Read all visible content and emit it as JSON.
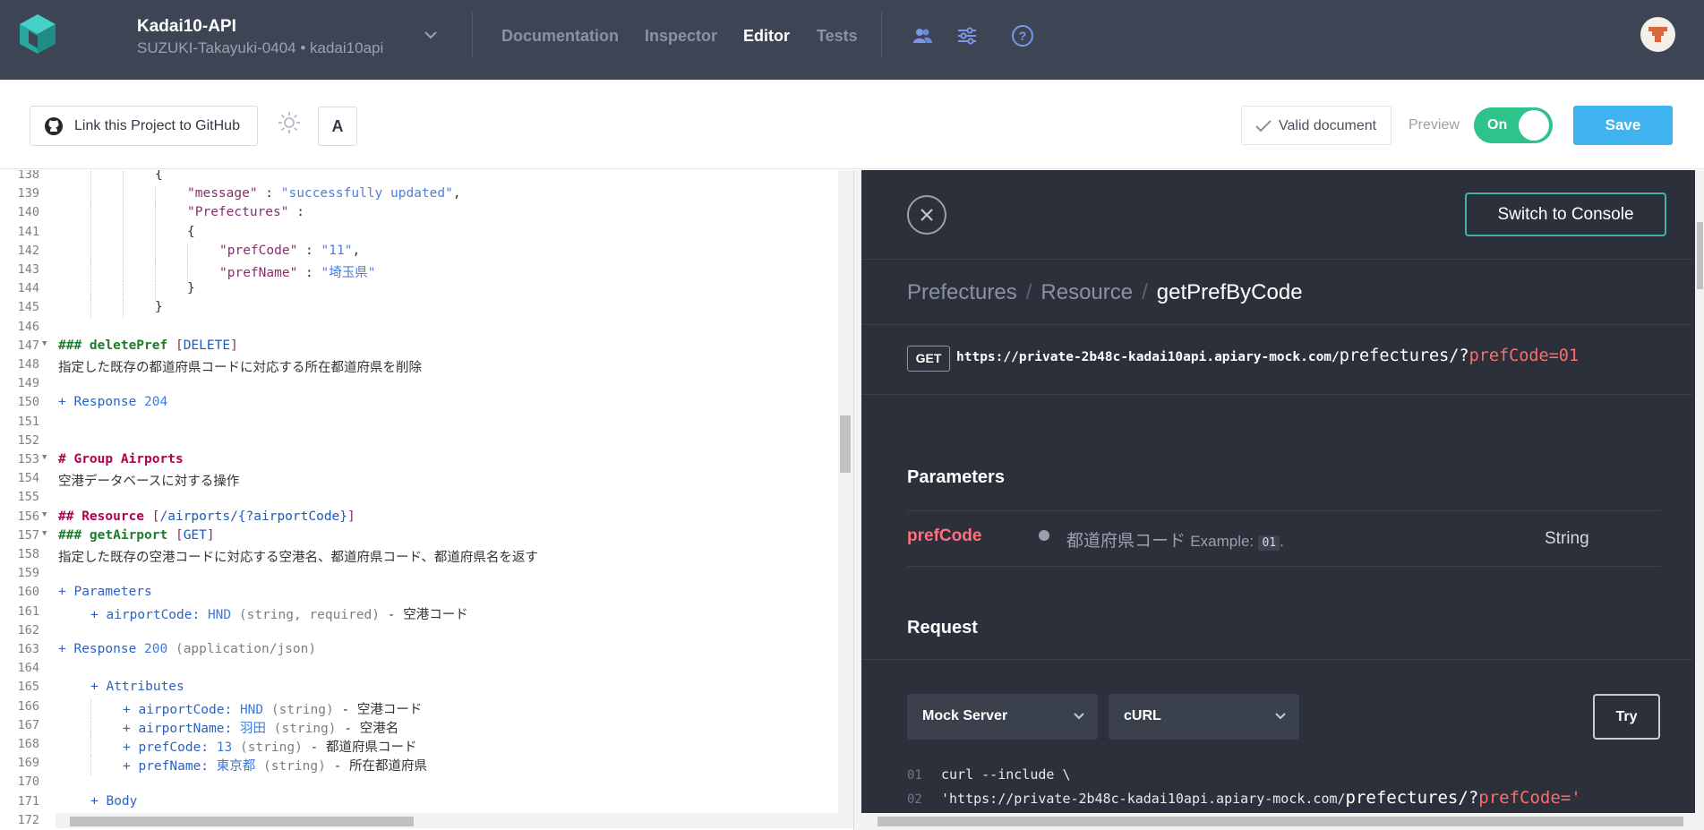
{
  "header": {
    "project_name": "Kadai10-API",
    "project_sub": "SUZUKI-Takayuki-0404 • kadai10api",
    "nav": [
      "Documentation",
      "Inspector",
      "Editor",
      "Tests"
    ],
    "active_nav": "Editor"
  },
  "toolbar": {
    "github_label": "Link this Project to GitHub",
    "font_label": "A",
    "valid_label": "Valid document",
    "preview_label": "Preview",
    "toggle_label": "On",
    "save_label": "Save"
  },
  "editor": {
    "lines": [
      {
        "num": "138",
        "fold": false,
        "indent": 3,
        "segs": [
          [
            "",
            "{"
          ]
        ]
      },
      {
        "num": "139",
        "fold": false,
        "indent": 4,
        "segs": [
          [
            "c-key",
            "\"message\""
          ],
          [
            "",
            " : "
          ],
          [
            "c-str",
            "\"successfully updated\""
          ],
          [
            "",
            ","
          ]
        ]
      },
      {
        "num": "140",
        "fold": false,
        "indent": 4,
        "segs": [
          [
            "c-key",
            "\"Prefectures\""
          ],
          [
            "",
            " :"
          ]
        ]
      },
      {
        "num": "141",
        "fold": false,
        "indent": 4,
        "segs": [
          [
            "",
            "{"
          ]
        ]
      },
      {
        "num": "142",
        "fold": false,
        "indent": 5,
        "segs": [
          [
            "c-key",
            "\"prefCode\""
          ],
          [
            "",
            " : "
          ],
          [
            "c-str",
            "\"11\""
          ],
          [
            "",
            ","
          ]
        ]
      },
      {
        "num": "143",
        "fold": false,
        "indent": 5,
        "segs": [
          [
            "c-key",
            "\"prefName\""
          ],
          [
            "",
            " : "
          ],
          [
            "c-str",
            "\"埼玉県\""
          ]
        ]
      },
      {
        "num": "144",
        "fold": false,
        "indent": 4,
        "segs": [
          [
            "",
            "}"
          ]
        ]
      },
      {
        "num": "145",
        "fold": false,
        "indent": 3,
        "segs": [
          [
            "",
            "}"
          ]
        ]
      },
      {
        "num": "146",
        "fold": false,
        "indent": 0,
        "segs": []
      },
      {
        "num": "147",
        "fold": true,
        "indent": 0,
        "segs": [
          [
            "c-green",
            "### deletePref "
          ],
          [
            "c-key",
            "["
          ],
          [
            "c-blue",
            "DELETE"
          ],
          [
            "c-key",
            "]"
          ]
        ]
      },
      {
        "num": "148",
        "fold": false,
        "indent": 0,
        "segs": [
          [
            "",
            "指定した既存の都道府県コードに対応する所在都道府県を削除"
          ]
        ]
      },
      {
        "num": "149",
        "fold": false,
        "indent": 0,
        "segs": []
      },
      {
        "num": "150",
        "fold": false,
        "indent": 0,
        "segs": [
          [
            "c-plus",
            "+ Response "
          ],
          [
            "c-val",
            "204"
          ]
        ]
      },
      {
        "num": "151",
        "fold": false,
        "indent": 0,
        "segs": []
      },
      {
        "num": "152",
        "fold": false,
        "indent": 0,
        "segs": []
      },
      {
        "num": "153",
        "fold": true,
        "indent": 0,
        "segs": [
          [
            "c-head",
            "# Group Airports"
          ]
        ]
      },
      {
        "num": "154",
        "fold": false,
        "indent": 0,
        "segs": [
          [
            "",
            "空港データベースに対する操作"
          ]
        ]
      },
      {
        "num": "155",
        "fold": false,
        "indent": 0,
        "segs": []
      },
      {
        "num": "156",
        "fold": true,
        "indent": 0,
        "segs": [
          [
            "c-head",
            "## Resource "
          ],
          [
            "c-key",
            "["
          ],
          [
            "c-blue",
            "/airports/{?airportCode}"
          ],
          [
            "c-key",
            "]"
          ]
        ]
      },
      {
        "num": "157",
        "fold": true,
        "indent": 0,
        "segs": [
          [
            "c-green",
            "### getAirport "
          ],
          [
            "c-key",
            "["
          ],
          [
            "c-blue",
            "GET"
          ],
          [
            "c-key",
            "]"
          ]
        ]
      },
      {
        "num": "158",
        "fold": false,
        "indent": 0,
        "segs": [
          [
            "",
            "指定した既存の空港コードに対応する空港名、都道府県コード、都道府県名を返す"
          ]
        ]
      },
      {
        "num": "159",
        "fold": false,
        "indent": 0,
        "segs": []
      },
      {
        "num": "160",
        "fold": false,
        "indent": 0,
        "segs": [
          [
            "c-plus",
            "+ Parameters"
          ]
        ]
      },
      {
        "num": "161",
        "fold": false,
        "indent": 1,
        "segs": [
          [
            "c-plus",
            "+ airportCode: "
          ],
          [
            "c-val",
            "HND"
          ],
          [
            "c-gray",
            " (string, required)"
          ],
          [
            "",
            " - 空港コード"
          ]
        ]
      },
      {
        "num": "162",
        "fold": false,
        "indent": 0,
        "segs": []
      },
      {
        "num": "163",
        "fold": false,
        "indent": 0,
        "segs": [
          [
            "c-plus",
            "+ Response "
          ],
          [
            "c-val",
            "200"
          ],
          [
            "c-gray",
            " (application/json)"
          ]
        ]
      },
      {
        "num": "164",
        "fold": false,
        "indent": 0,
        "segs": []
      },
      {
        "num": "165",
        "fold": false,
        "indent": 1,
        "segs": [
          [
            "c-plus",
            "+ Attributes"
          ]
        ]
      },
      {
        "num": "166",
        "fold": false,
        "indent": 2,
        "segs": [
          [
            "c-plus",
            "+ airportCode: "
          ],
          [
            "c-val",
            "HND"
          ],
          [
            "c-gray",
            " (string)"
          ],
          [
            "",
            " - 空港コード"
          ]
        ]
      },
      {
        "num": "167",
        "fold": false,
        "indent": 2,
        "segs": [
          [
            "c-plus",
            "+ airportName: "
          ],
          [
            "c-val",
            "羽田"
          ],
          [
            "c-gray",
            " (string)"
          ],
          [
            "",
            " - 空港名"
          ]
        ]
      },
      {
        "num": "168",
        "fold": false,
        "indent": 2,
        "segs": [
          [
            "c-plus",
            "+ prefCode: "
          ],
          [
            "c-val",
            "13"
          ],
          [
            "c-gray",
            " (string)"
          ],
          [
            "",
            " - 都道府県コード"
          ]
        ]
      },
      {
        "num": "169",
        "fold": false,
        "indent": 2,
        "segs": [
          [
            "c-plus",
            "+ prefName: "
          ],
          [
            "c-val",
            "東京都"
          ],
          [
            "c-gray",
            " (string)"
          ],
          [
            "",
            " - 所在都道府県"
          ]
        ]
      },
      {
        "num": "170",
        "fold": false,
        "indent": 0,
        "segs": []
      },
      {
        "num": "171",
        "fold": false,
        "indent": 1,
        "segs": [
          [
            "c-plus",
            "+ Body"
          ]
        ]
      },
      {
        "num": "172",
        "fold": false,
        "indent": 0,
        "segs": []
      }
    ]
  },
  "preview": {
    "console_label": "Switch to Console",
    "breadcrumb": [
      "Prefectures",
      "Resource",
      "getPrefByCode"
    ],
    "method": "GET",
    "url_host": "https://private-2b48c-kadai10api.apiary-mock.com/",
    "url_path": "prefectures/?",
    "url_param": "prefCode=01",
    "parameters_title": "Parameters",
    "param": {
      "name": "prefCode",
      "description": "都道府県コード",
      "example_label": "Example:",
      "example_value": "01",
      "example_suffix": ".",
      "type": "String"
    },
    "request_title": "Request",
    "server_select": "Mock Server",
    "lang_select": "cURL",
    "try_label": "Try",
    "code_lines": [
      {
        "num": "01",
        "text": "curl --include \\"
      },
      {
        "num": "02",
        "text": "'https://private-2b48c-kadai10api.apiary-mock.com/",
        "path": "prefectures/?",
        "param": "prefCode='"
      }
    ]
  },
  "colors": {
    "header_bg": "#3d4454",
    "preview_bg": "#2b303b",
    "save": "#3fb3ef",
    "toggle": "#2ec38a",
    "console_border": "#3fb5a1",
    "param_name": "#ff6f7d"
  }
}
